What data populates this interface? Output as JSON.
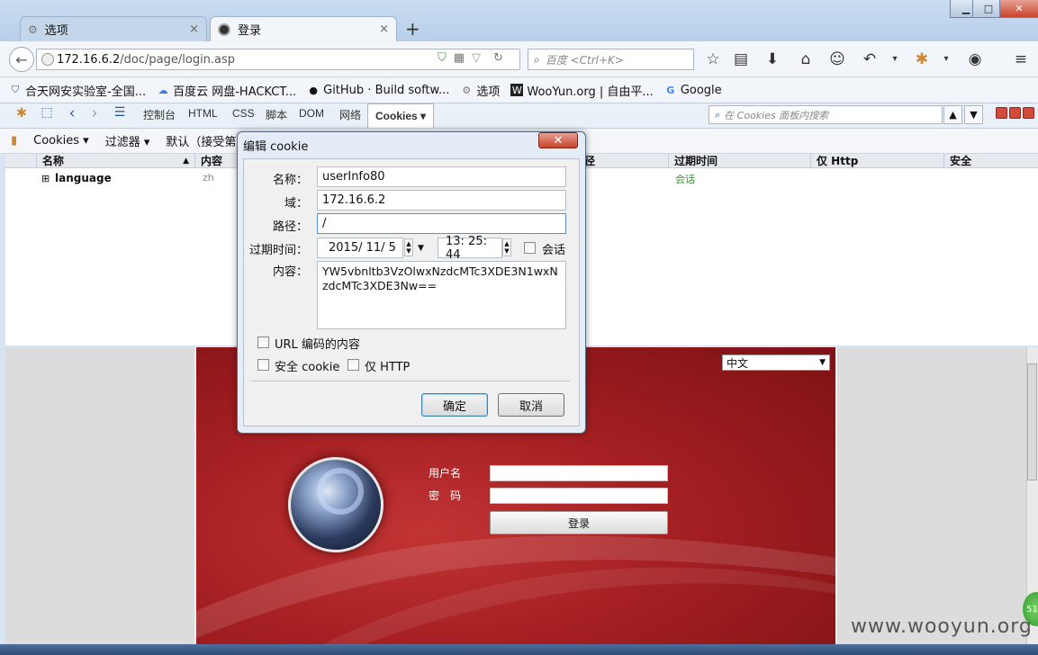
{
  "browser": {
    "tabs": [
      {
        "label": "选项",
        "close": "×"
      },
      {
        "label": "登录",
        "close": "×"
      }
    ],
    "new_tab": "+",
    "window_controls": {
      "minimize": "▁",
      "maximize": "□",
      "close": "✕"
    },
    "url_host": "172.16.6.2",
    "url_path": "/doc/page/login.asp",
    "search_placeholder": "百度 <Ctrl+K>"
  },
  "bookmarks": [
    {
      "icon": "shield-icon",
      "label": "合天网安实验室-全国..."
    },
    {
      "icon": "cloud-icon",
      "label": "百度云 网盘-HACKCT..."
    },
    {
      "icon": "github-icon",
      "label": "GitHub · Build softw..."
    },
    {
      "icon": "gear-icon",
      "label": "选项"
    },
    {
      "icon": "wooyun-icon",
      "label": "WooYun.org | 自由平..."
    },
    {
      "icon": "google-icon",
      "label": "Google"
    }
  ],
  "firebug": {
    "tabs": [
      "控制台",
      "HTML",
      "CSS",
      "脚本",
      "DOM",
      "网络"
    ],
    "active_tab": "Cookies ▾",
    "search_placeholder": "在 Cookies 面板内搜索"
  },
  "cookies_toolbar": {
    "cookies_menu": "Cookies ▾",
    "filter_menu": "过滤器 ▾",
    "default_menu": "默认（接受第"
  },
  "table": {
    "headers": {
      "name": "名称",
      "content": "内容",
      "path": "径",
      "expires": "过期时间",
      "http_only": "仅 Http",
      "secure": "安全"
    },
    "rows": [
      {
        "expand": "⊞",
        "name": "language",
        "content": "zh",
        "expires": "会话"
      }
    ]
  },
  "dialog": {
    "title": "编辑 cookie",
    "close": "✕",
    "name_label": "名称：",
    "name_value": "userInfo80",
    "domain_label": "域：",
    "domain_value": "172.16.6.2",
    "path_label": "路径：",
    "path_value": "/",
    "expires_label": "过期时间：",
    "expires_date": "2015/ 11/  5",
    "expires_time": "13: 25: 44",
    "session_label": "会话",
    "content_label": "内容：",
    "content_value": "YW5vbnltb3VzOlwxNzdcMTc3XDE3N1wxNzdcMTc3XDE3Nw==",
    "url_encode_label": "URL 编码的内容",
    "secure_label": "安全 cookie",
    "http_only_label": "仅 HTTP",
    "ok_label": "确定",
    "cancel_label": "取消"
  },
  "login_page": {
    "language_select": "中文",
    "username_label": "用户名",
    "password_label": "密　码",
    "login_button": "登录"
  },
  "watermark": "www.wooyun.org",
  "badge": "51"
}
